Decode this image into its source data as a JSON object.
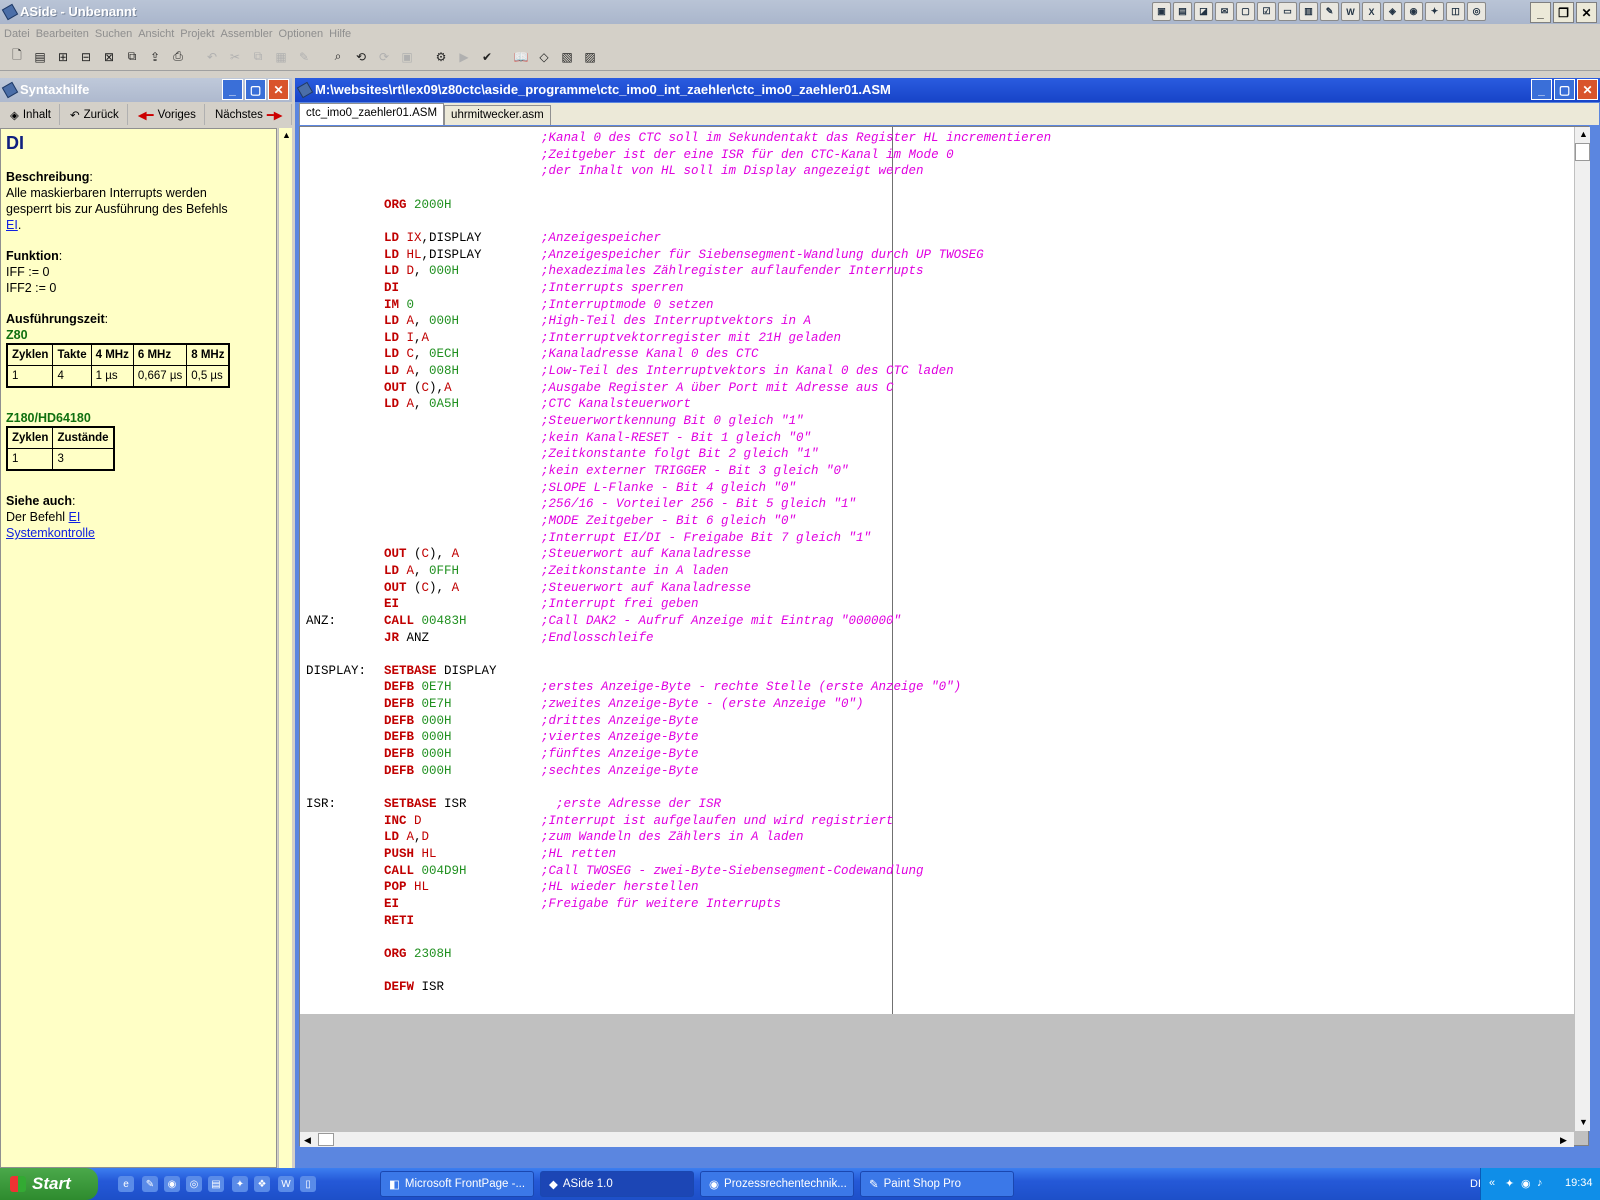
{
  "app": {
    "title": "ASide - Unbenannt"
  },
  "menu": [
    "Datei",
    "Bearbeiten",
    "Suchen",
    "Ansicht",
    "Projekt",
    "Assembler",
    "Optionen",
    "Hilfe"
  ],
  "help": {
    "panel_title": "Syntaxhilfe",
    "nav": {
      "inhalt": "Inhalt",
      "zurueck": "Zurück",
      "voriges": "Voriges",
      "naechstes": "Nächstes"
    },
    "heading": "DI",
    "beschreibung_label": "Beschreibung",
    "beschreibung_text": "Alle maskierbaren Interrupts werden gesperrt bis zur Ausführung des Befehls",
    "beschreibung_link": "EI",
    "funktion_label": "Funktion",
    "funktion_lines": [
      "IFF := 0",
      "IFF2 := 0"
    ],
    "ausfuehrung_label": "Ausführungszeit",
    "z80_label": "Z80",
    "z80_headers": [
      "Zyklen",
      "Takte",
      "4 MHz",
      "6 MHz",
      "8 MHz"
    ],
    "z80_values": [
      "1",
      "4",
      "1 µs",
      "0,667 µs",
      "0,5 µs"
    ],
    "z180_label": "Z180/HD64180",
    "z180_headers": [
      "Zyklen",
      "Zustände"
    ],
    "z180_values": [
      "1",
      "3"
    ],
    "siehe_label": "Siehe auch",
    "siehe_text": "Der Befehl",
    "siehe_link1": "EI",
    "siehe_link2": "Systemkontrolle"
  },
  "editor": {
    "window_title": "M:\\websites\\rt\\lex09\\z80ctc\\aside_programme\\ctc_imo0_int_zaehler\\ctc_imo0_zaehler01.ASM",
    "tabs": [
      "ctc_imo0_zaehler01.ASM",
      "uhrmitwecker.asm"
    ]
  },
  "code": [
    {
      "l": "",
      "i": "",
      "o": [],
      "c": ";Kanal 0 des CTC soll im Sekundentakt das Register HL incrementieren"
    },
    {
      "l": "",
      "i": "",
      "o": [],
      "c": ";Zeitgeber ist der eine ISR für den CTC-Kanal im Mode 0"
    },
    {
      "l": "",
      "i": "",
      "o": [],
      "c": ";der Inhalt von HL soll im Display angezeigt werden"
    },
    {
      "l": "",
      "i": "",
      "o": [],
      "c": ""
    },
    {
      "l": "",
      "i": "ORG",
      "t": "dr",
      "o": [
        [
          "num",
          "2000H"
        ]
      ],
      "c": ""
    },
    {
      "l": "",
      "i": "",
      "o": [],
      "c": ""
    },
    {
      "l": "",
      "i": "LD",
      "t": "kw",
      "o": [
        [
          "reg",
          "IX"
        ],
        [
          "sym",
          ",DISPLAY"
        ]
      ],
      "c": ";Anzeigespeicher"
    },
    {
      "l": "",
      "i": "LD",
      "t": "kw",
      "o": [
        [
          "reg",
          "HL"
        ],
        [
          "sym",
          ",DISPLAY"
        ]
      ],
      "c": ";Anzeigespeicher für Siebensegment-Wandlung durch UP TWOSEG"
    },
    {
      "l": "",
      "i": "LD",
      "t": "kw",
      "o": [
        [
          "reg",
          "D"
        ],
        [
          "sym",
          ", "
        ],
        [
          "num",
          "000H"
        ]
      ],
      "c": ";hexadezimales Zählregister auflaufender Interrupts"
    },
    {
      "l": "",
      "i": "DI",
      "t": "kw",
      "o": [],
      "c": ";Interrupts sperren"
    },
    {
      "l": "",
      "i": "IM",
      "t": "kw",
      "o": [
        [
          "num",
          "0"
        ]
      ],
      "c": ";Interruptmode 0 setzen"
    },
    {
      "l": "",
      "i": "LD",
      "t": "kw",
      "o": [
        [
          "reg",
          "A"
        ],
        [
          "sym",
          ", "
        ],
        [
          "num",
          "000H"
        ]
      ],
      "c": ";High-Teil des Interruptvektors in A"
    },
    {
      "l": "",
      "i": "LD",
      "t": "kw",
      "o": [
        [
          "reg",
          "I"
        ],
        [
          "sym",
          ","
        ],
        [
          "reg",
          "A"
        ]
      ],
      "c": ";Interruptvektorregister mit 21H geladen"
    },
    {
      "l": "",
      "i": "LD",
      "t": "kw",
      "o": [
        [
          "reg",
          "C"
        ],
        [
          "sym",
          ", "
        ],
        [
          "num",
          "0ECH"
        ]
      ],
      "c": ";Kanaladresse Kanal 0 des CTC"
    },
    {
      "l": "",
      "i": "LD",
      "t": "kw",
      "o": [
        [
          "reg",
          "A"
        ],
        [
          "sym",
          ", "
        ],
        [
          "num",
          "008H"
        ]
      ],
      "c": ";Low-Teil des Interruptvektors in Kanal 0 des CTC laden"
    },
    {
      "l": "",
      "i": "OUT",
      "t": "kw",
      "o": [
        [
          "sym",
          "("
        ],
        [
          "reg",
          "C"
        ],
        [
          "sym",
          "),"
        ],
        [
          "reg",
          "A"
        ]
      ],
      "c": ";Ausgabe Register A über Port mit Adresse aus C"
    },
    {
      "l": "",
      "i": "LD",
      "t": "kw",
      "o": [
        [
          "reg",
          "A"
        ],
        [
          "sym",
          ", "
        ],
        [
          "num",
          "0A5H"
        ]
      ],
      "c": ";CTC Kanalsteuerwort"
    },
    {
      "l": "",
      "i": "",
      "o": [],
      "c": ";Steuerwortkennung Bit 0 gleich \"1\""
    },
    {
      "l": "",
      "i": "",
      "o": [],
      "c": ";kein Kanal-RESET - Bit 1 gleich \"0\""
    },
    {
      "l": "",
      "i": "",
      "o": [],
      "c": ";Zeitkonstante folgt Bit 2 gleich \"1\""
    },
    {
      "l": "",
      "i": "",
      "o": [],
      "c": ";kein externer TRIGGER - Bit 3 gleich \"0\""
    },
    {
      "l": "",
      "i": "",
      "o": [],
      "c": ";SLOPE L-Flanke - Bit 4 gleich \"0\""
    },
    {
      "l": "",
      "i": "",
      "o": [],
      "c": ";256/16 - Vorteiler 256 - Bit 5 gleich \"1\""
    },
    {
      "l": "",
      "i": "",
      "o": [],
      "c": ";MODE Zeitgeber - Bit 6 gleich \"0\""
    },
    {
      "l": "",
      "i": "",
      "o": [],
      "c": ";Interrupt EI/DI - Freigabe Bit 7 gleich \"1\""
    },
    {
      "l": "",
      "i": "OUT",
      "t": "kw",
      "o": [
        [
          "sym",
          "("
        ],
        [
          "reg",
          "C"
        ],
        [
          "sym",
          "), "
        ],
        [
          "reg",
          "A"
        ]
      ],
      "c": ";Steuerwort auf Kanaladresse"
    },
    {
      "l": "",
      "i": "LD",
      "t": "kw",
      "o": [
        [
          "reg",
          "A"
        ],
        [
          "sym",
          ", "
        ],
        [
          "num",
          "0FFH"
        ]
      ],
      "c": ";Zeitkonstante in A laden"
    },
    {
      "l": "",
      "i": "OUT",
      "t": "kw",
      "o": [
        [
          "sym",
          "("
        ],
        [
          "reg",
          "C"
        ],
        [
          "sym",
          "), "
        ],
        [
          "reg",
          "A"
        ]
      ],
      "c": ";Steuerwort auf Kanaladresse"
    },
    {
      "l": "",
      "i": "EI",
      "t": "kw",
      "o": [],
      "c": ";Interrupt frei geben"
    },
    {
      "l": "ANZ:",
      "i": "CALL",
      "t": "kw",
      "o": [
        [
          "num",
          "00483H"
        ]
      ],
      "c": ";Call DAK2 - Aufruf Anzeige mit Eintrag \"000000\""
    },
    {
      "l": "",
      "i": "JR",
      "t": "kw",
      "o": [
        [
          "sym",
          "ANZ"
        ]
      ],
      "c": ";Endlosschleife"
    },
    {
      "l": "",
      "i": "",
      "o": [],
      "c": ""
    },
    {
      "l": "DISPLAY:",
      "i": "SETBASE",
      "t": "dr",
      "o": [
        [
          "sym",
          "DISPLAY"
        ]
      ],
      "c": ""
    },
    {
      "l": "",
      "i": "DEFB",
      "t": "dr",
      "o": [
        [
          "num",
          "0E7H"
        ]
      ],
      "c": ";erstes Anzeige-Byte - rechte Stelle (erste Anzeige \"0\")"
    },
    {
      "l": "",
      "i": "DEFB",
      "t": "dr",
      "o": [
        [
          "num",
          "0E7H"
        ]
      ],
      "c": ";zweites Anzeige-Byte - (erste Anzeige \"0\")"
    },
    {
      "l": "",
      "i": "DEFB",
      "t": "dr",
      "o": [
        [
          "num",
          "000H"
        ]
      ],
      "c": ";drittes Anzeige-Byte"
    },
    {
      "l": "",
      "i": "DEFB",
      "t": "dr",
      "o": [
        [
          "num",
          "000H"
        ]
      ],
      "c": ";viertes Anzeige-Byte"
    },
    {
      "l": "",
      "i": "DEFB",
      "t": "dr",
      "o": [
        [
          "num",
          "000H"
        ]
      ],
      "c": ";fünftes Anzeige-Byte"
    },
    {
      "l": "",
      "i": "DEFB",
      "t": "dr",
      "o": [
        [
          "num",
          "000H"
        ]
      ],
      "c": ";sechtes Anzeige-Byte"
    },
    {
      "l": "",
      "i": "",
      "o": [],
      "c": ""
    },
    {
      "l": "ISR:",
      "i": "SETBASE",
      "t": "dr",
      "o": [
        [
          "sym",
          "ISR"
        ]
      ],
      "c": "  ;erste Adresse der ISR"
    },
    {
      "l": "",
      "i": "INC",
      "t": "kw",
      "o": [
        [
          "reg",
          "D"
        ]
      ],
      "c": ";Interrupt ist aufgelaufen und wird registriert"
    },
    {
      "l": "",
      "i": "LD",
      "t": "kw",
      "o": [
        [
          "reg",
          "A"
        ],
        [
          "sym",
          ","
        ],
        [
          "reg",
          "D"
        ]
      ],
      "c": ";zum Wandeln des Zählers in A laden"
    },
    {
      "l": "",
      "i": "PUSH",
      "t": "kw",
      "o": [
        [
          "reg",
          "HL"
        ]
      ],
      "c": ";HL retten"
    },
    {
      "l": "",
      "i": "CALL",
      "t": "kw",
      "o": [
        [
          "num",
          "004D9H"
        ]
      ],
      "c": ";Call TWOSEG - zwei-Byte-Siebensegment-Codewandlung"
    },
    {
      "l": "",
      "i": "POP",
      "t": "kw",
      "o": [
        [
          "reg",
          "HL"
        ]
      ],
      "c": ";HL wieder herstellen"
    },
    {
      "l": "",
      "i": "EI",
      "t": "kw",
      "o": [],
      "c": ";Freigabe für weitere Interrupts"
    },
    {
      "l": "",
      "i": "RETI",
      "t": "dr",
      "o": [],
      "c": ""
    },
    {
      "l": "",
      "i": "",
      "o": [],
      "c": ""
    },
    {
      "l": "",
      "i": "ORG",
      "t": "dr",
      "o": [
        [
          "num",
          "2308H"
        ]
      ],
      "c": ""
    },
    {
      "l": "",
      "i": "",
      "o": [],
      "c": ""
    },
    {
      "l": "",
      "i": "DEFW",
      "t": "dr",
      "o": [
        [
          "sym",
          "ISR"
        ]
      ],
      "c": ""
    }
  ],
  "taskbar": {
    "start": "Start",
    "tasks": [
      "Microsoft FrontPage -...",
      "ASide 1.0",
      "Prozessrechentechnik...",
      "Paint Shop Pro"
    ],
    "lang": "DE",
    "clock": "19:34"
  }
}
